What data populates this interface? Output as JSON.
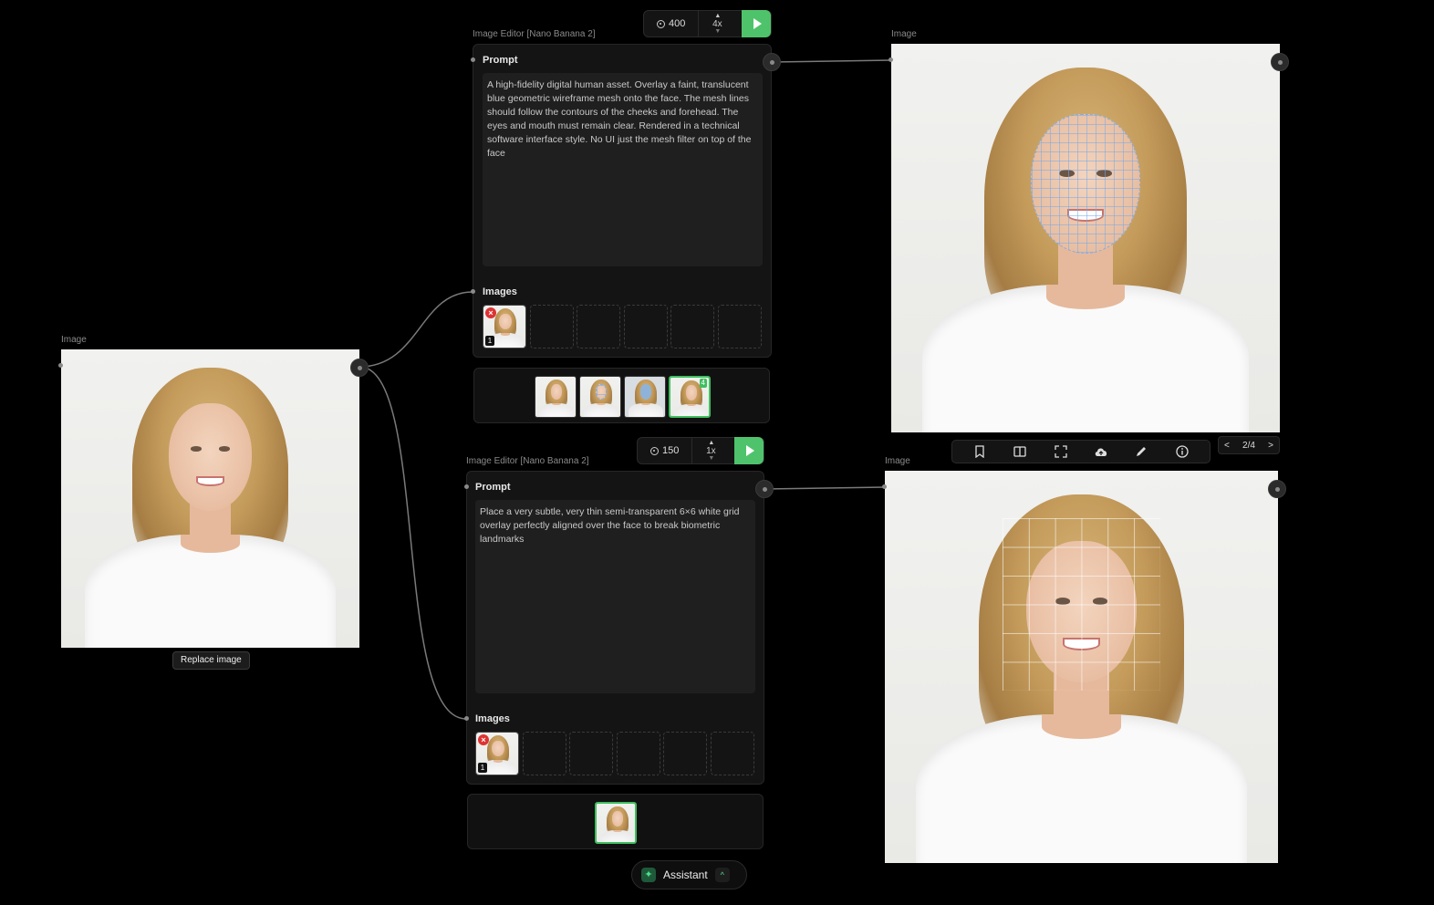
{
  "source_node": {
    "caption": "Image",
    "replace_label": "Replace image"
  },
  "editor_top": {
    "caption": "Image Editor [Nano Banana 2]",
    "credits": "400",
    "multiplier": "4x",
    "prompt_label": "Prompt",
    "prompt_text": "A high-fidelity digital human asset. Overlay a faint, translucent blue geometric wireframe mesh onto the face. The mesh lines should follow the contours of the cheeks and forehead. The eyes and mouth must remain clear. Rendered in a technical software interface style. No UI just the mesh filter on top of the face",
    "images_label": "Images",
    "slot_badge": "1",
    "gallery_count": "4"
  },
  "editor_bottom": {
    "caption": "Image Editor [Nano Banana 2]",
    "credits": "150",
    "multiplier": "1x",
    "prompt_label": "Prompt",
    "prompt_text": "Place a very subtle, very thin semi-transparent 6×6 white grid overlay perfectly aligned over the face to break biometric landmarks",
    "images_label": "Images",
    "slot_badge": "1"
  },
  "output_top": {
    "caption": "Image",
    "pager": "2/4",
    "pager_prev": "<",
    "pager_next": ">",
    "toolbar_icons": [
      "bookmark-icon",
      "compare-icon",
      "fullscreen-icon",
      "cloud-upload-icon",
      "pencil-icon",
      "info-icon"
    ]
  },
  "output_bottom": {
    "caption": "Image"
  },
  "assistant": {
    "label": "Assistant",
    "icon": "sparkle-icon",
    "caret": "^"
  },
  "colors": {
    "background": "#000000",
    "panel": "#141414",
    "accent_green": "#4fc36b",
    "error_red": "#dd3333"
  }
}
